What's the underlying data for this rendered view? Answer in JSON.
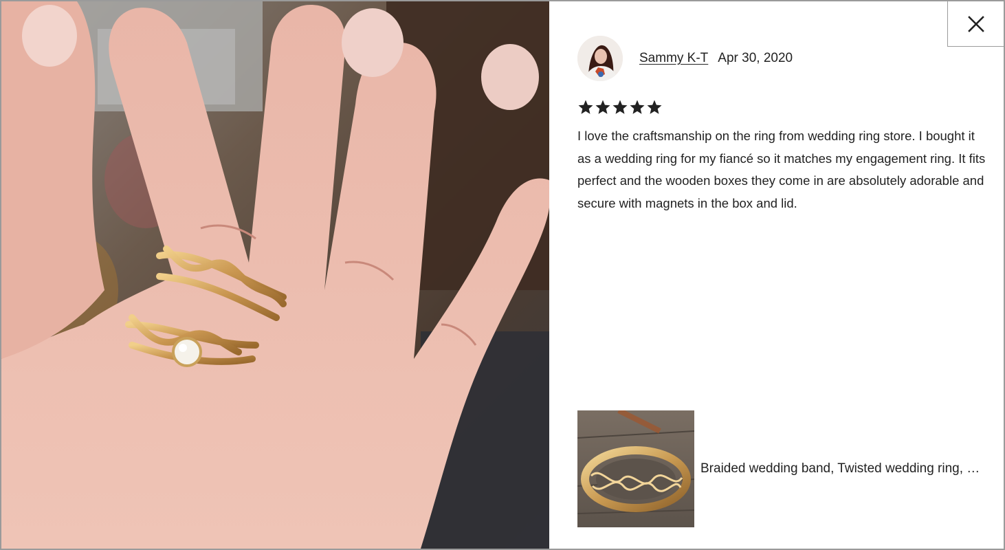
{
  "review": {
    "reviewer_name": "Sammy K-T",
    "date": "Apr 30, 2020",
    "rating": 5,
    "rating_max": 5,
    "text": "I love the craftsmanship on the ring from wedding ring store. I bought it as a wedding ring for my fiancé so it matches my engagement ring. It fits perfect and the wooden boxes they come in are absolutely adorable and secure with magnets in the box and lid."
  },
  "item": {
    "title": "Braided wedding band, Twisted wedding ring, Gold braided band"
  },
  "icons": {
    "close": "close-icon",
    "star": "star-icon"
  },
  "colors": {
    "text": "#222222",
    "border": "#9b9b9b",
    "gold": "#c9a15a"
  }
}
